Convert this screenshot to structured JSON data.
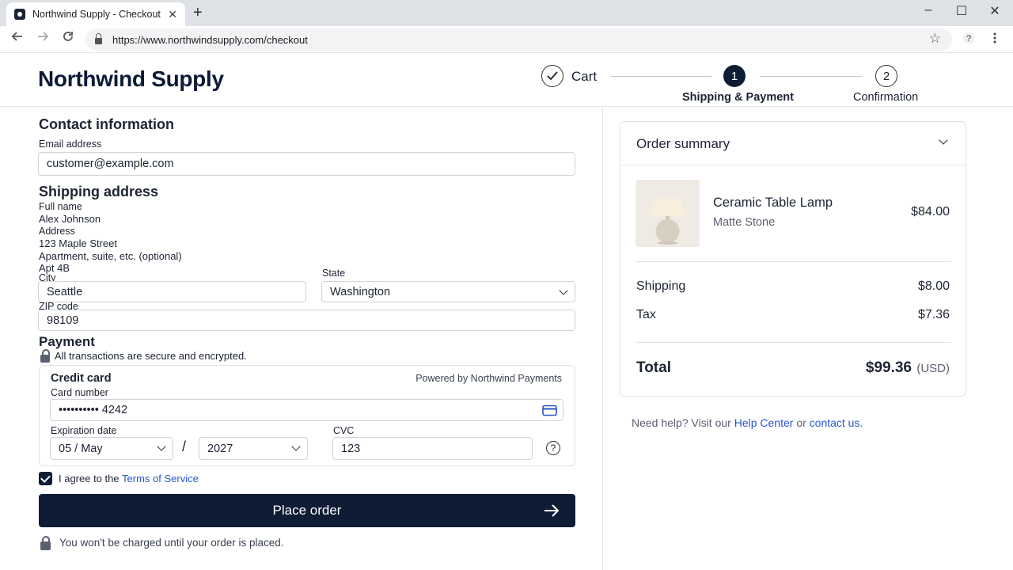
{
  "browser": {
    "tab_title": "Northwind Supply - Checkout",
    "tab_close": "✕",
    "new_tab": "+",
    "url": "https://www.northwindsupply.com/checkout",
    "window_minimize": "–",
    "window_maximize": "☐",
    "window_close": "✕"
  },
  "header": {
    "logo": "Northwind Supply",
    "steps": [
      {
        "label": "Cart",
        "state": "done"
      },
      {
        "label": "Shipping & Payment",
        "number": "1",
        "state": "current"
      },
      {
        "label": "Confirmation",
        "number": "2",
        "state": "upcoming"
      }
    ]
  },
  "contact": {
    "heading": "Contact information",
    "email_label": "Email address",
    "email_value": "customer@example.com"
  },
  "shipping": {
    "heading": "Shipping address",
    "full_name_label": "Full name",
    "full_name_value": "Alex Johnson",
    "address_label": "Address",
    "address_value": "123 Maple Street",
    "apt_label": "Apartment, suite, etc. (optional)",
    "apt_value": "Apt 4B",
    "city_label": "City",
    "city_value": "Seattle",
    "state_label": "State",
    "state_value": "Washington",
    "zip_label": "ZIP code",
    "zip_value": "98109"
  },
  "payment": {
    "heading": "Payment",
    "secure_note": "All transactions are secure and encrypted.",
    "method_title": "Credit card",
    "powered_by": "Powered by Northwind Payments",
    "card_number_label": "Card number",
    "card_number_value": "•••••••••• 4242",
    "expiration_label": "Expiration date",
    "exp_month_value": "05 / May",
    "exp_separator": "/",
    "exp_year_value": "2027",
    "cvc_label": "CVC",
    "cvc_value": "123",
    "help_glyph": "?"
  },
  "terms": {
    "checked": true,
    "prefix": "I agree to the",
    "link": "Terms of Service"
  },
  "actions": {
    "place_order": "Place order",
    "charge_note": "You won't be charged until your order is placed."
  },
  "summary": {
    "heading": "Order summary",
    "item_name": "Ceramic Table Lamp",
    "item_variant": "Matte Stone",
    "item_price": "$84.00",
    "shipping_label": "Shipping",
    "shipping_value": "$8.00",
    "tax_label": "Tax",
    "tax_value": "$7.36",
    "total_label": "Total",
    "total_value": "$99.36",
    "currency": "(USD)"
  },
  "help": {
    "prefix": "Need help? Visit our",
    "help_center": "Help Center",
    "or": "or",
    "contact": "contact us."
  },
  "colors": {
    "brand_navy": "#0e1c36",
    "link_blue": "#2657c9"
  }
}
